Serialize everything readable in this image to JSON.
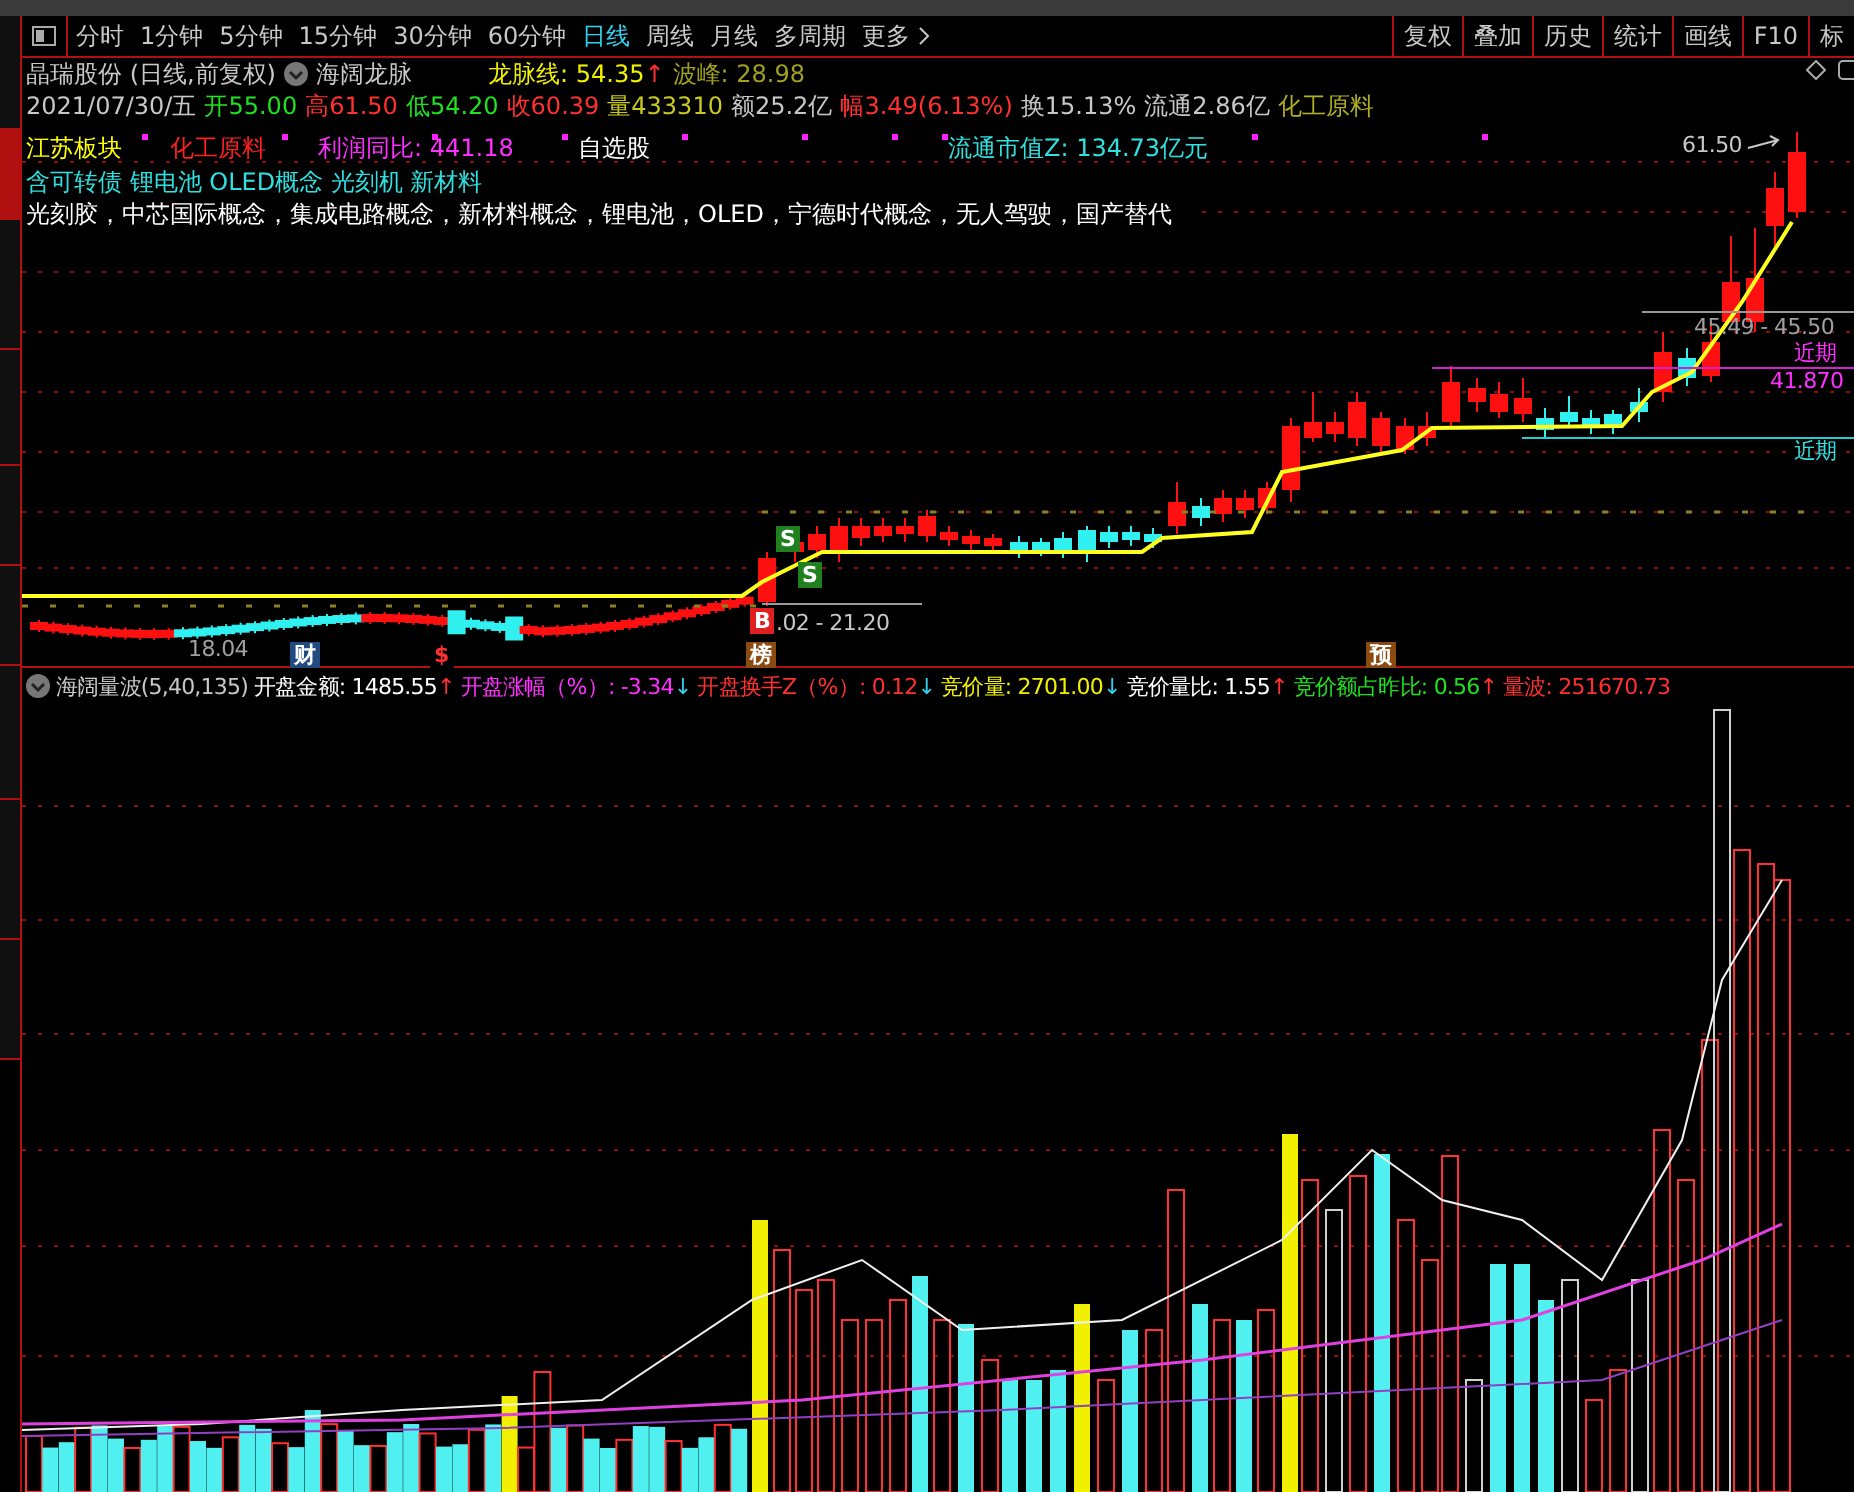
{
  "side_tabs": [
    {
      "selected": false
    },
    {
      "selected": true
    },
    {
      "selected": false
    },
    {
      "selected": false
    },
    {
      "selected": false
    },
    {
      "selected": false
    },
    {
      "selected": false
    },
    {
      "selected": false
    },
    {
      "selected": false
    }
  ],
  "toolbar": {
    "periods": [
      {
        "label": "分时",
        "selected": false
      },
      {
        "label": "1分钟",
        "selected": false
      },
      {
        "label": "5分钟",
        "selected": false
      },
      {
        "label": "15分钟",
        "selected": false
      },
      {
        "label": "30分钟",
        "selected": false
      },
      {
        "label": "60分钟",
        "selected": false
      },
      {
        "label": "日线",
        "selected": true
      },
      {
        "label": "周线",
        "selected": false
      },
      {
        "label": "月线",
        "selected": false
      },
      {
        "label": "多周期",
        "selected": false
      },
      {
        "label": "更多",
        "selected": false
      }
    ],
    "buttons": [
      "复权",
      "叠加",
      "历史",
      "统计",
      "画线",
      "F10",
      "标"
    ]
  },
  "header": {
    "title": "晶瑞股份 (日线,前复权)",
    "indicator": "海阔龙脉",
    "indicator_values": [
      {
        "text": "龙脉线: 54.35",
        "color": "#f0f000",
        "arrow": {
          "text": "↑",
          "color": "#ff3030"
        }
      },
      {
        "text": "波峰: 28.98",
        "color": "#a0a020"
      }
    ],
    "quote": [
      {
        "text": "2021/07/30/五",
        "color": "#c8c8c8"
      },
      {
        "text": "开55.00",
        "color": "#20e020"
      },
      {
        "text": "高61.50",
        "color": "#ff3030"
      },
      {
        "text": "低54.20",
        "color": "#20e020"
      },
      {
        "text": "收60.39",
        "color": "#ff3030"
      },
      {
        "text": "量433310",
        "color": "#c8c820"
      },
      {
        "text": "额25.2亿",
        "color": "#c8c8c8"
      },
      {
        "text": "幅3.49(6.13%)",
        "color": "#ff3030"
      },
      {
        "text": "换15.13%",
        "color": "#c8c8c8"
      },
      {
        "text": "流通2.86亿",
        "color": "#c8c8c8"
      },
      {
        "text": "化工原料",
        "color": "#b0b020"
      }
    ]
  },
  "chart": {
    "tags": [
      {
        "text": "江苏板块",
        "color": "#ffff00"
      },
      {
        "text": "化工原料",
        "color": "#ff2020"
      },
      {
        "text": "利润同比: 441.18",
        "color": "#ff30ff"
      },
      {
        "text": "自选股",
        "color": "#ffffff"
      },
      {
        "text": "流通市值Z: 134.73亿元",
        "color": "#30e0e0"
      }
    ],
    "concepts": "含可转债 锂电池 OLED概念 光刻机 新材料",
    "themes": "光刻胶，中芯国际概念，集成电路概念，新材料概念，锂电池，OLED，宁德时代概念，无人驾驶，国产替代",
    "labels": [
      {
        "text": "61.50",
        "color": "#c8c8c8"
      },
      {
        "text": "45.49 - 45.50",
        "color": "#a0a0a0"
      },
      {
        "text": "近期",
        "color": "#ff30ff"
      },
      {
        "text": "41.870",
        "color": "#ff30ff"
      },
      {
        "text": "近期",
        "color": "#30e0e0"
      },
      {
        "text": ".02 - 21.20",
        "color": "#c8c8c8"
      },
      {
        "text": "18.04",
        "color": "#a0a0a0"
      }
    ],
    "markers": [
      {
        "text": "S",
        "color": "#208020"
      },
      {
        "text": "S",
        "color": "#208020"
      },
      {
        "text": "B",
        "color": "#e02020"
      },
      {
        "text": "财",
        "color": "#204a80"
      },
      {
        "text": "$",
        "color": "#000000"
      },
      {
        "text": "榜",
        "color": "#8a4a10"
      },
      {
        "text": "预",
        "color": "#8a4a10"
      }
    ]
  },
  "volume": {
    "title": "海阔量波(5,40,135)",
    "stats": [
      {
        "text": "开盘金额: 1485.55",
        "color": "#ffffff",
        "arrow": {
          "text": "↑",
          "color": "#ff3030"
        }
      },
      {
        "text": "开盘涨幅（%）: -3.34",
        "color": "#ff30ff",
        "arrow": {
          "text": "↓",
          "color": "#30d0f0"
        }
      },
      {
        "text": "开盘换手Z（%）: 0.12",
        "color": "#ff3030",
        "arrow": {
          "text": "↓",
          "color": "#30d0f0"
        }
      },
      {
        "text": "竞价量: 2701.00",
        "color": "#f0f000",
        "arrow": {
          "text": "↓",
          "color": "#30d0f0"
        }
      },
      {
        "text": "竞价量比: 1.55",
        "color": "#ffffff",
        "arrow": {
          "text": "↑",
          "color": "#ff3030"
        }
      },
      {
        "text": "竞价额占昨比: 0.56",
        "color": "#20e020",
        "arrow": {
          "text": "↑",
          "color": "#ff3030"
        }
      },
      {
        "text": "量波: 251670.73",
        "color": "#ff3030"
      }
    ]
  }
}
